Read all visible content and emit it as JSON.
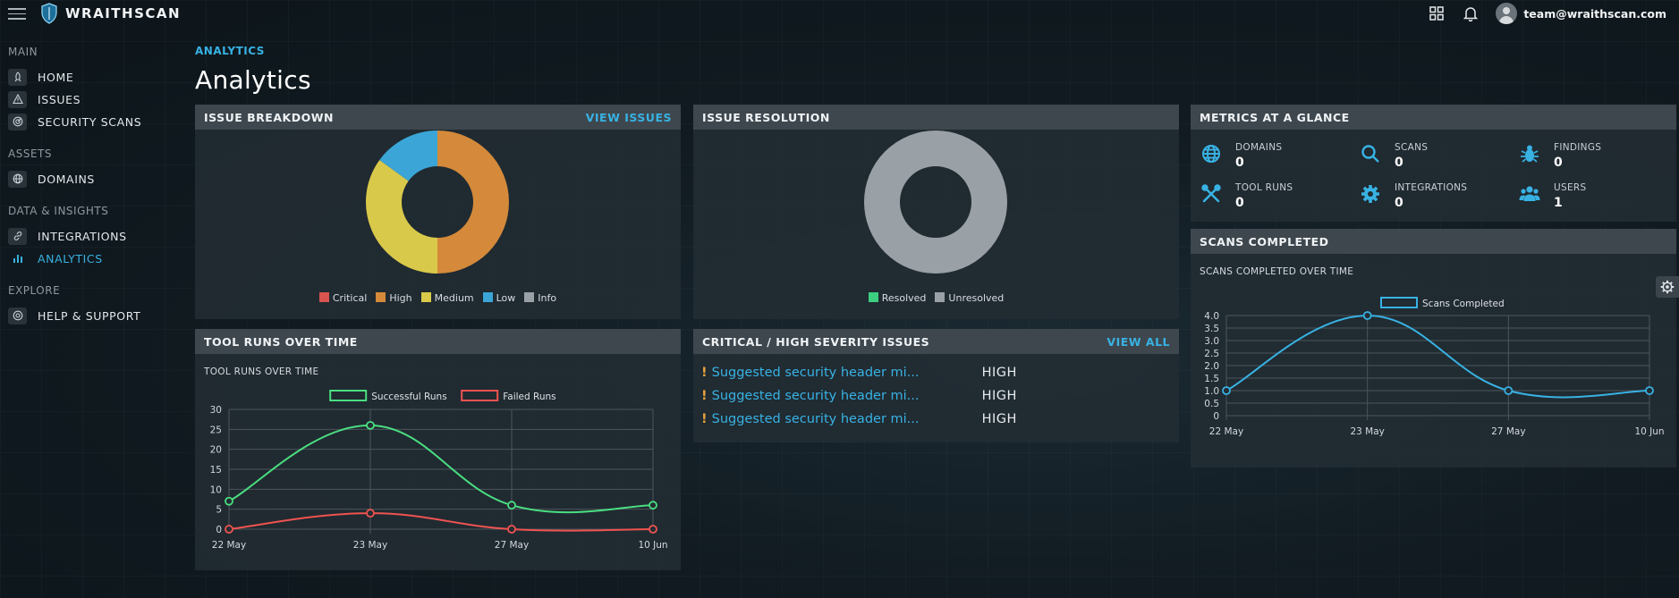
{
  "app": {
    "brand": "WRAITHSCAN"
  },
  "topbar": {
    "user_email": "team@wraithscan.com",
    "icons": [
      "grid-icon",
      "bell-icon",
      "user-avatar"
    ]
  },
  "sidebar": {
    "sections": [
      {
        "title": "MAIN",
        "items": [
          {
            "label": "HOME",
            "icon": "rocket-icon"
          },
          {
            "label": "ISSUES",
            "icon": "warning-icon"
          },
          {
            "label": "SECURITY SCANS",
            "icon": "radar-icon"
          }
        ]
      },
      {
        "title": "ASSETS",
        "items": [
          {
            "label": "DOMAINS",
            "icon": "globe-icon"
          }
        ]
      },
      {
        "title": "DATA & INSIGHTS",
        "items": [
          {
            "label": "INTEGRATIONS",
            "icon": "link-icon"
          },
          {
            "label": "ANALYTICS",
            "icon": "bar-chart-icon",
            "active": true
          }
        ]
      },
      {
        "title": "EXPLORE",
        "items": [
          {
            "label": "HELP & SUPPORT",
            "icon": "help-icon"
          }
        ]
      }
    ]
  },
  "page": {
    "breadcrumb": "ANALYTICS",
    "title": "Analytics"
  },
  "issue_breakdown": {
    "title": "ISSUE BREAKDOWN",
    "link": "VIEW ISSUES",
    "legend": [
      {
        "label": "Critical",
        "color": "#d9534f"
      },
      {
        "label": "High",
        "color": "#d48a3a"
      },
      {
        "label": "Medium",
        "color": "#d9c94a"
      },
      {
        "label": "Low",
        "color": "#3aa5d6"
      },
      {
        "label": "Info",
        "color": "#9aa1a6"
      }
    ]
  },
  "issue_resolution": {
    "title": "ISSUE RESOLUTION",
    "legend": [
      {
        "label": "Resolved",
        "color": "#3ccf7f"
      },
      {
        "label": "Unresolved",
        "color": "#9aa1a6"
      }
    ]
  },
  "metrics": {
    "title": "METRICS AT A GLANCE",
    "items": [
      {
        "label": "DOMAINS",
        "value": "0",
        "icon": "globe-icon"
      },
      {
        "label": "SCANS",
        "value": "0",
        "icon": "search-icon"
      },
      {
        "label": "FINDINGS",
        "value": "0",
        "icon": "bug-icon"
      },
      {
        "label": "TOOL RUNS",
        "value": "0",
        "icon": "tools-icon"
      },
      {
        "label": "INTEGRATIONS",
        "value": "0",
        "icon": "gear-icon"
      },
      {
        "label": "USERS",
        "value": "1",
        "icon": "users-icon"
      }
    ]
  },
  "tool_runs": {
    "title": "TOOL RUNS OVER TIME",
    "subtitle": "TOOL RUNS OVER TIME"
  },
  "critical_issues": {
    "title": "CRITICAL / HIGH SEVERITY ISSUES",
    "link": "VIEW ALL",
    "rows": [
      {
        "text": "Suggested security header missing",
        "severity": "HIGH"
      },
      {
        "text": "Suggested security header missing",
        "severity": "HIGH"
      },
      {
        "text": "Suggested security header missing",
        "severity": "HIGH"
      }
    ]
  },
  "scans_completed": {
    "title": "SCANS COMPLETED",
    "subtitle": "SCANS COMPLETED OVER TIME"
  },
  "chart_data": [
    {
      "type": "pie",
      "donut": true,
      "categories": [
        "Critical",
        "High",
        "Medium",
        "Low",
        "Info"
      ],
      "values": [
        0,
        50,
        35,
        15,
        0
      ],
      "colors": [
        "#d9534f",
        "#d48a3a",
        "#d9c94a",
        "#3aa5d6",
        "#9aa1a6"
      ],
      "legend": "bottom"
    },
    {
      "type": "pie",
      "donut": true,
      "categories": [
        "Resolved",
        "Unresolved"
      ],
      "values": [
        0,
        100
      ],
      "colors": [
        "#3ccf7f",
        "#9aa1a6"
      ],
      "legend": "bottom"
    },
    {
      "type": "line",
      "title": "TOOL RUNS OVER TIME",
      "categories": [
        "22 May",
        "23 May",
        "27 May",
        "10 Jun"
      ],
      "series": [
        {
          "name": "Successful Runs",
          "values": [
            7,
            26,
            6,
            6
          ],
          "color": "#4ade80"
        },
        {
          "name": "Failed Runs",
          "values": [
            0,
            4,
            0,
            0
          ],
          "color": "#ef5350"
        }
      ],
      "ylim": [
        0,
        30
      ],
      "yticks": [
        0,
        5,
        10,
        15,
        20,
        25,
        30
      ],
      "grid": true,
      "legend": "top"
    },
    {
      "type": "line",
      "title": "SCANS COMPLETED OVER TIME",
      "categories": [
        "22 May",
        "23 May",
        "27 May",
        "10 Jun"
      ],
      "series": [
        {
          "name": "Scans Completed",
          "values": [
            1,
            4,
            1,
            1
          ],
          "color": "#38b2e3"
        }
      ],
      "ylim": [
        0,
        4
      ],
      "yticks": [
        "0",
        "0.5",
        "1.0",
        "1.5",
        "2.0",
        "2.5",
        "3.0",
        "3.5",
        "4.0"
      ],
      "grid": true,
      "legend": "top"
    }
  ]
}
